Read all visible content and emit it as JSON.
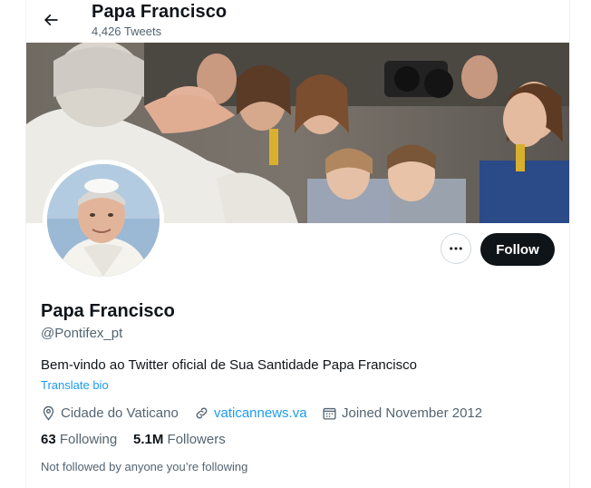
{
  "header": {
    "title": "Papa Francisco",
    "tweet_count": "4,426 Tweets"
  },
  "profile": {
    "name": "Papa Francisco",
    "handle": "@Pontifex_pt",
    "bio": "Bem-vindo ao Twitter oficial de Sua Santidade Papa Francisco",
    "translate_label": "Translate bio",
    "location": "Cidade do Vaticano",
    "website": "vaticannews.va",
    "joined": "Joined November 2012",
    "following_count": "63",
    "following_label": "Following",
    "followers_count": "5.1M",
    "followers_label": "Followers",
    "not_followed_text": "Not followed by anyone you’re following"
  },
  "actions": {
    "follow_label": "Follow",
    "more_icon": "more-horizontal-icon"
  },
  "icons": {
    "back": "arrow-left-icon",
    "location": "location-pin-icon",
    "link": "link-icon",
    "calendar": "calendar-icon"
  },
  "colors": {
    "accent": "#1d9bf0",
    "text": "#0f1419",
    "secondary": "#536471",
    "button": "#0f1419"
  }
}
